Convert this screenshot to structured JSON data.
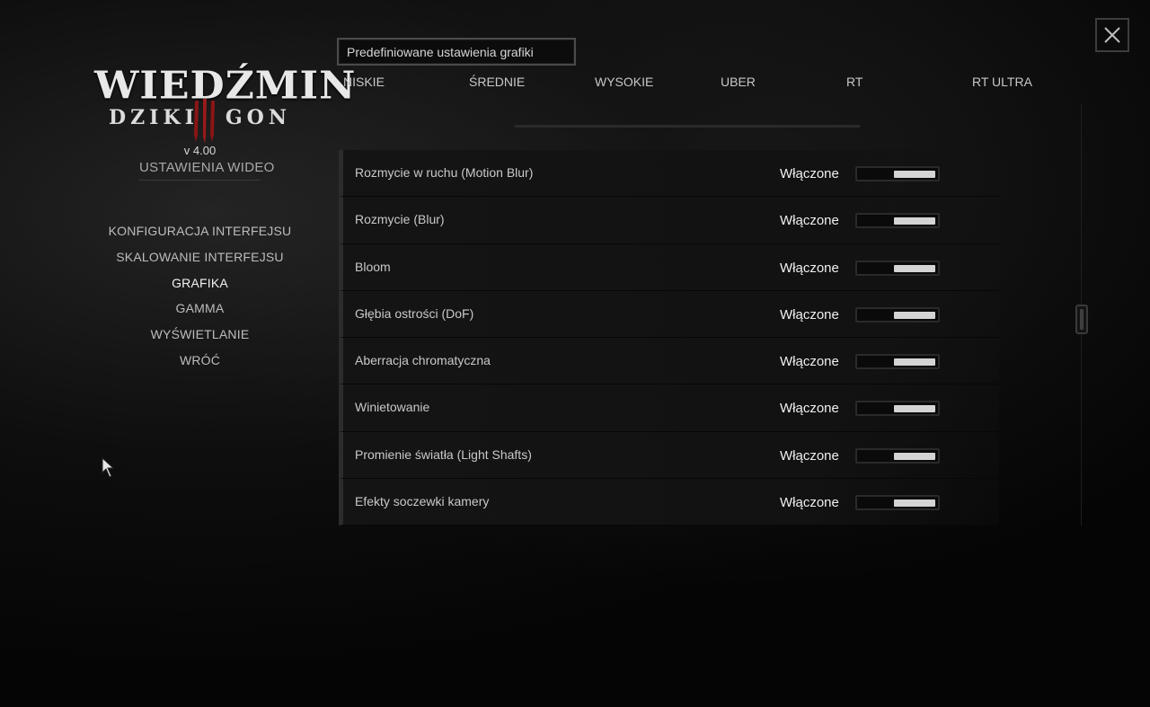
{
  "logo": {
    "title": "WIEDŹMIN",
    "sub_left": "DZIKI",
    "sub_right": "GON",
    "claw_color": "#8b1515"
  },
  "version": "v 4.00",
  "panel_title": "USTAWIENIA WIDEO",
  "menu": [
    {
      "label": "KONFIGURACJA INTERFEJSU",
      "active": false
    },
    {
      "label": "SKALOWANIE INTERFEJSU",
      "active": false
    },
    {
      "label": "GRAFIKA",
      "active": true
    },
    {
      "label": "GAMMA",
      "active": false
    },
    {
      "label": "WYŚWIETLANIE",
      "active": false
    },
    {
      "label": "WRÓĆ",
      "active": false
    }
  ],
  "preset": {
    "title": "Predefiniowane ustawienia grafiki",
    "options": [
      "NISKIE",
      "ŚREDNIE",
      "WYSOKIE",
      "UBER",
      "RT",
      "RT ULTRA"
    ]
  },
  "close_label": "X",
  "settings": [
    {
      "label": "Rozmycie w ruchu (Motion Blur)",
      "value": "Włączone",
      "on": true
    },
    {
      "label": "Rozmycie (Blur)",
      "value": "Włączone",
      "on": true
    },
    {
      "label": "Bloom",
      "value": "Włączone",
      "on": true
    },
    {
      "label": "Głębia ostrości (DoF)",
      "value": "Włączone",
      "on": true
    },
    {
      "label": "Aberracja chromatyczna",
      "value": "Włączone",
      "on": true
    },
    {
      "label": "Winietowanie",
      "value": "Włączone",
      "on": true
    },
    {
      "label": "Promienie światła (Light Shafts)",
      "value": "Włączone",
      "on": true
    },
    {
      "label": "Efekty soczewki kamery",
      "value": "Włączone",
      "on": true
    }
  ]
}
